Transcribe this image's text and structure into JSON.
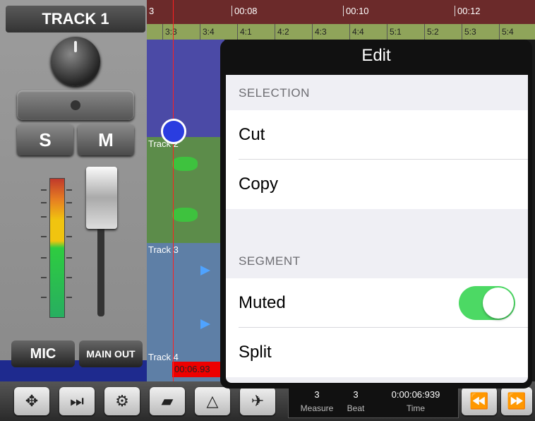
{
  "mixer": {
    "track_title": "TRACK 1",
    "solo_label": "S",
    "mute_label": "M",
    "input_label": "MIC",
    "output_label": "MAIN OUT"
  },
  "timeline": {
    "ruler_labels": [
      "3",
      "00:08",
      "00:10",
      "00:12"
    ],
    "beat_labels": [
      "3:3",
      "3:4",
      "4:1",
      "4:2",
      "4:3",
      "4:4",
      "5:1",
      "5:2",
      "5:3",
      "5:4"
    ],
    "tracks": [
      "Track 2",
      "Track 3",
      "Track 4"
    ],
    "playhead_time": "00:06.93"
  },
  "edit_popover": {
    "title": "Edit",
    "selection_header": "SELECTION",
    "cut_label": "Cut",
    "copy_label": "Copy",
    "segment_header": "SEGMENT",
    "muted_label": "Muted",
    "muted_on": true,
    "split_label": "Split"
  },
  "toolbar": {
    "icons": [
      "move-icon",
      "skip-icon",
      "gear-icon",
      "folder-icon",
      "metronome-icon",
      "airplane-icon",
      "rewind-icon",
      "fast-forward-icon"
    ],
    "readout": {
      "measure_value": "3",
      "measure_label": "Measure",
      "beat_value": "3",
      "beat_label": "Beat",
      "time_value": "0:00:06:939",
      "time_label": "Time"
    }
  },
  "colors": {
    "toggle_on": "#4cd964",
    "playhead": "#ff2020",
    "ruler": "#6b2a2a"
  }
}
